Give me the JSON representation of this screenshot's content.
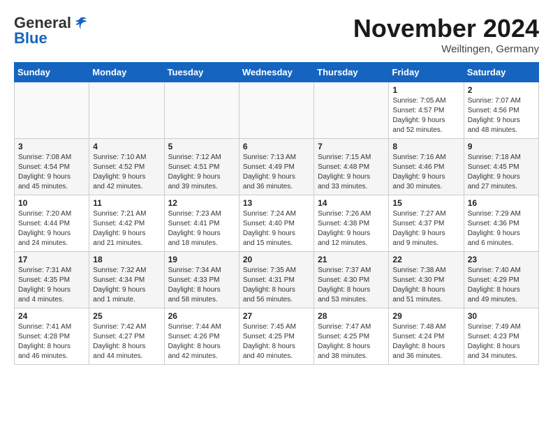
{
  "header": {
    "logo_general": "General",
    "logo_blue": "Blue",
    "month_title": "November 2024",
    "subtitle": "Weiltingen, Germany"
  },
  "days_of_week": [
    "Sunday",
    "Monday",
    "Tuesday",
    "Wednesday",
    "Thursday",
    "Friday",
    "Saturday"
  ],
  "weeks": [
    [
      {
        "day": "",
        "info": ""
      },
      {
        "day": "",
        "info": ""
      },
      {
        "day": "",
        "info": ""
      },
      {
        "day": "",
        "info": ""
      },
      {
        "day": "",
        "info": ""
      },
      {
        "day": "1",
        "info": "Sunrise: 7:05 AM\nSunset: 4:57 PM\nDaylight: 9 hours\nand 52 minutes."
      },
      {
        "day": "2",
        "info": "Sunrise: 7:07 AM\nSunset: 4:56 PM\nDaylight: 9 hours\nand 48 minutes."
      }
    ],
    [
      {
        "day": "3",
        "info": "Sunrise: 7:08 AM\nSunset: 4:54 PM\nDaylight: 9 hours\nand 45 minutes."
      },
      {
        "day": "4",
        "info": "Sunrise: 7:10 AM\nSunset: 4:52 PM\nDaylight: 9 hours\nand 42 minutes."
      },
      {
        "day": "5",
        "info": "Sunrise: 7:12 AM\nSunset: 4:51 PM\nDaylight: 9 hours\nand 39 minutes."
      },
      {
        "day": "6",
        "info": "Sunrise: 7:13 AM\nSunset: 4:49 PM\nDaylight: 9 hours\nand 36 minutes."
      },
      {
        "day": "7",
        "info": "Sunrise: 7:15 AM\nSunset: 4:48 PM\nDaylight: 9 hours\nand 33 minutes."
      },
      {
        "day": "8",
        "info": "Sunrise: 7:16 AM\nSunset: 4:46 PM\nDaylight: 9 hours\nand 30 minutes."
      },
      {
        "day": "9",
        "info": "Sunrise: 7:18 AM\nSunset: 4:45 PM\nDaylight: 9 hours\nand 27 minutes."
      }
    ],
    [
      {
        "day": "10",
        "info": "Sunrise: 7:20 AM\nSunset: 4:44 PM\nDaylight: 9 hours\nand 24 minutes."
      },
      {
        "day": "11",
        "info": "Sunrise: 7:21 AM\nSunset: 4:42 PM\nDaylight: 9 hours\nand 21 minutes."
      },
      {
        "day": "12",
        "info": "Sunrise: 7:23 AM\nSunset: 4:41 PM\nDaylight: 9 hours\nand 18 minutes."
      },
      {
        "day": "13",
        "info": "Sunrise: 7:24 AM\nSunset: 4:40 PM\nDaylight: 9 hours\nand 15 minutes."
      },
      {
        "day": "14",
        "info": "Sunrise: 7:26 AM\nSunset: 4:38 PM\nDaylight: 9 hours\nand 12 minutes."
      },
      {
        "day": "15",
        "info": "Sunrise: 7:27 AM\nSunset: 4:37 PM\nDaylight: 9 hours\nand 9 minutes."
      },
      {
        "day": "16",
        "info": "Sunrise: 7:29 AM\nSunset: 4:36 PM\nDaylight: 9 hours\nand 6 minutes."
      }
    ],
    [
      {
        "day": "17",
        "info": "Sunrise: 7:31 AM\nSunset: 4:35 PM\nDaylight: 9 hours\nand 4 minutes."
      },
      {
        "day": "18",
        "info": "Sunrise: 7:32 AM\nSunset: 4:34 PM\nDaylight: 9 hours\nand 1 minute."
      },
      {
        "day": "19",
        "info": "Sunrise: 7:34 AM\nSunset: 4:33 PM\nDaylight: 8 hours\nand 58 minutes."
      },
      {
        "day": "20",
        "info": "Sunrise: 7:35 AM\nSunset: 4:31 PM\nDaylight: 8 hours\nand 56 minutes."
      },
      {
        "day": "21",
        "info": "Sunrise: 7:37 AM\nSunset: 4:30 PM\nDaylight: 8 hours\nand 53 minutes."
      },
      {
        "day": "22",
        "info": "Sunrise: 7:38 AM\nSunset: 4:30 PM\nDaylight: 8 hours\nand 51 minutes."
      },
      {
        "day": "23",
        "info": "Sunrise: 7:40 AM\nSunset: 4:29 PM\nDaylight: 8 hours\nand 49 minutes."
      }
    ],
    [
      {
        "day": "24",
        "info": "Sunrise: 7:41 AM\nSunset: 4:28 PM\nDaylight: 8 hours\nand 46 minutes."
      },
      {
        "day": "25",
        "info": "Sunrise: 7:42 AM\nSunset: 4:27 PM\nDaylight: 8 hours\nand 44 minutes."
      },
      {
        "day": "26",
        "info": "Sunrise: 7:44 AM\nSunset: 4:26 PM\nDaylight: 8 hours\nand 42 minutes."
      },
      {
        "day": "27",
        "info": "Sunrise: 7:45 AM\nSunset: 4:25 PM\nDaylight: 8 hours\nand 40 minutes."
      },
      {
        "day": "28",
        "info": "Sunrise: 7:47 AM\nSunset: 4:25 PM\nDaylight: 8 hours\nand 38 minutes."
      },
      {
        "day": "29",
        "info": "Sunrise: 7:48 AM\nSunset: 4:24 PM\nDaylight: 8 hours\nand 36 minutes."
      },
      {
        "day": "30",
        "info": "Sunrise: 7:49 AM\nSunset: 4:23 PM\nDaylight: 8 hours\nand 34 minutes."
      }
    ]
  ]
}
